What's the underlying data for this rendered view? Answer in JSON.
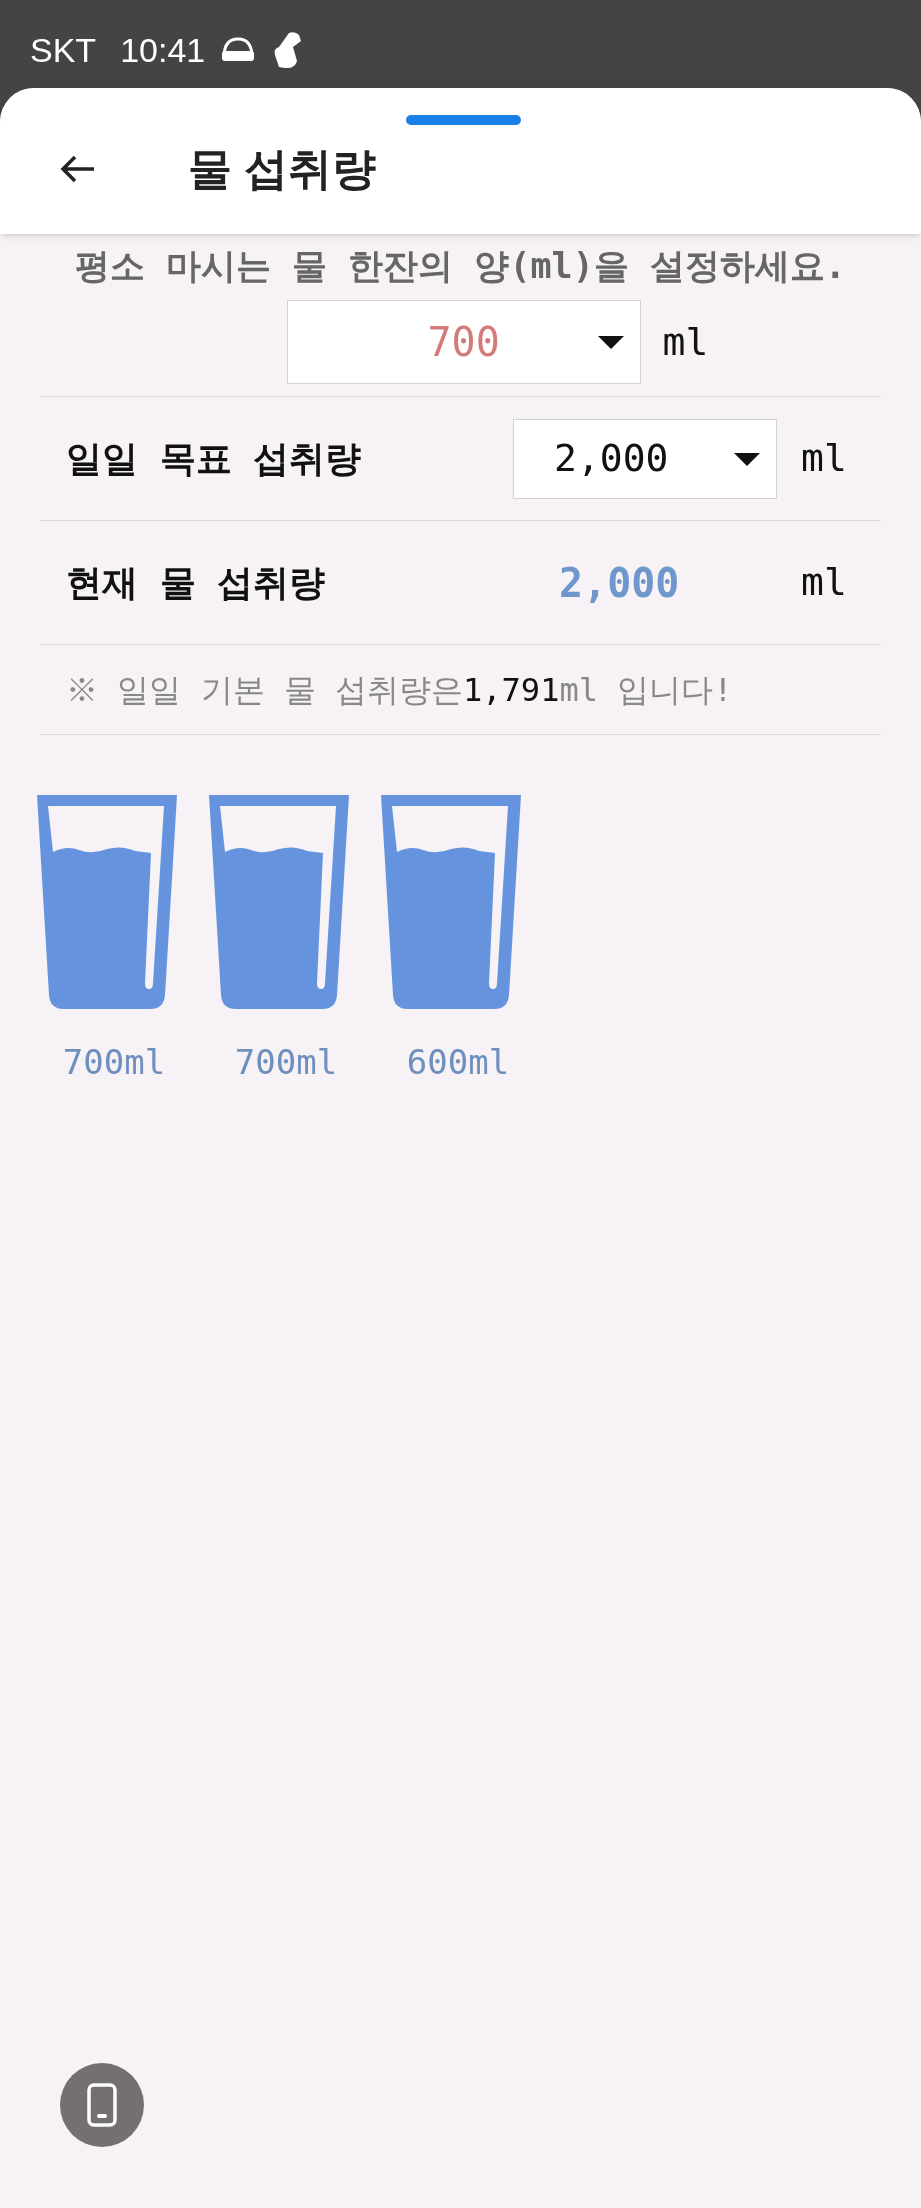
{
  "status_bar": {
    "carrier": "SKT",
    "time": "10:41"
  },
  "header": {
    "title": "물 섭취량"
  },
  "cup_setting": {
    "instruction": "평소 마시는 물 한잔의 양(ml)을 설정하세요.",
    "value": "700",
    "unit": "ml"
  },
  "rows": [
    {
      "kind": "dropdown",
      "label": "일일 목표 섭취량",
      "value": "2,000",
      "unit": "ml"
    },
    {
      "kind": "readout",
      "label": "현재 물 섭취량",
      "value": "2,000",
      "unit": "ml"
    }
  ],
  "note": {
    "prefix": "※ 일일 기본 물 섭취량은",
    "value": "1,791",
    "suffix": "ml 입니다!"
  },
  "glasses": [
    {
      "amount": "700ml"
    },
    {
      "amount": "700ml"
    },
    {
      "amount": "600ml"
    }
  ]
}
